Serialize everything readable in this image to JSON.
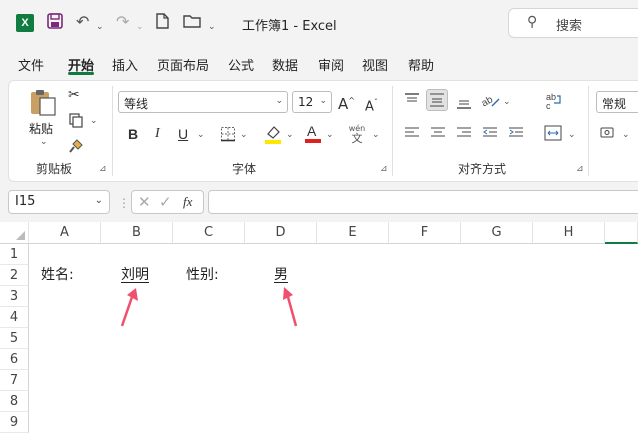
{
  "window": {
    "title": "工作簿1  -  Excel",
    "search_placeholder": "搜索",
    "logo": "X"
  },
  "tabs": [
    "文件",
    "开始",
    "插入",
    "页面布局",
    "公式",
    "数据",
    "审阅",
    "视图",
    "帮助"
  ],
  "ribbon": {
    "clipboard": {
      "paste_label": "粘贴",
      "group_label": "剪贴板"
    },
    "font": {
      "font_name": "等线",
      "font_size": "12",
      "group_label": "字体",
      "bold": "B",
      "italic": "I",
      "underline": "U",
      "phonetic_top": "wén",
      "phonetic_bottom": "文",
      "grow": "A",
      "shrink": "A"
    },
    "alignment": {
      "group_label": "对齐方式"
    },
    "number": {
      "format": "常规"
    }
  },
  "formula_bar": {
    "name_box": "I15",
    "fx": "fx",
    "value": ""
  },
  "sheet": {
    "columns": [
      "A",
      "B",
      "C",
      "D",
      "E",
      "F",
      "G",
      "H"
    ],
    "rows": [
      "1",
      "2",
      "3",
      "4",
      "5",
      "6",
      "7",
      "8",
      "9"
    ],
    "cells": {
      "A2": "姓名:",
      "B2": "刘明",
      "C2": "性别:",
      "D2": "男"
    }
  },
  "colors": {
    "accent": "#107c41",
    "arrow": "#f0506e",
    "font_color": "#e02020",
    "highlight": "#ffe600"
  }
}
